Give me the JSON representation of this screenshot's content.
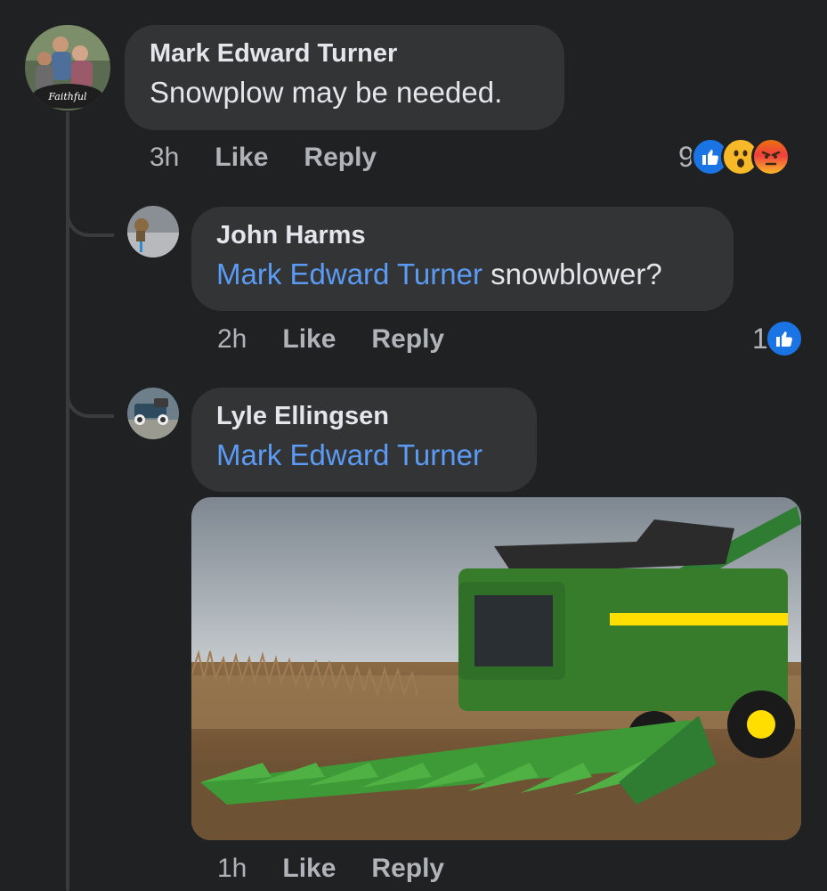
{
  "comments": [
    {
      "author": "Mark Edward Turner",
      "text": "Snowplow may be needed.",
      "time": "3h",
      "like_label": "Like",
      "reply_label": "Reply",
      "reaction_count": "9",
      "reactions": [
        "like-icon",
        "wow-icon",
        "angry-icon"
      ]
    },
    {
      "author": "John Harms",
      "mention": "Mark Edward Turner",
      "text": "snowblower?",
      "time": "2h",
      "like_label": "Like",
      "reply_label": "Reply",
      "reaction_count": "1",
      "reactions": [
        "like-icon"
      ]
    },
    {
      "author": "Lyle Ellingsen",
      "mention": "Mark Edward Turner",
      "attachment": "combine-harvester-photo",
      "time": "1h",
      "like_label": "Like",
      "reply_label": "Reply"
    }
  ],
  "colors": {
    "background": "#1f2122",
    "bubble": "#333435",
    "mention": "#5b9bf3",
    "like_blue": "#1b74e4",
    "tractor_green": "#367c2b",
    "tractor_yellow": "#ffde00"
  }
}
